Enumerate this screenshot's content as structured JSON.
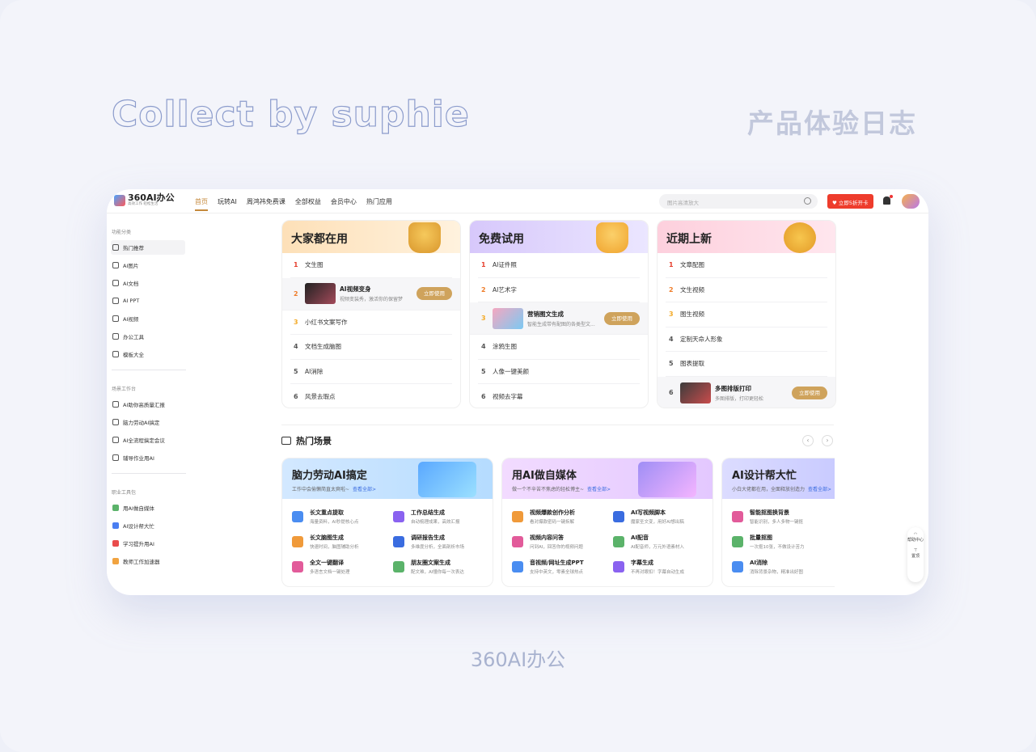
{
  "banner": {
    "left": "Collect by suphie",
    "right": "产品体验日志"
  },
  "caption": "360AI办公",
  "app": {
    "logo": {
      "name": "360AI办公",
      "slogan": "高效工作 轻松生活"
    },
    "nav": [
      "首页",
      "玩转AI",
      "周鸿祎免费课",
      "全部权益",
      "会员中心",
      "热门应用"
    ],
    "nav_active": "首页",
    "search_placeholder": "图片高清放大",
    "vip_button": "立即5折开卡",
    "colors": {
      "accent": "#c5893c",
      "vip": "#ee3c2c",
      "rank1": "#e6402f",
      "rank2": "#ef7d2a",
      "rank3": "#f3aa27"
    }
  },
  "sidebar": {
    "sections": [
      {
        "title": "功能分类",
        "items": [
          "热门推荐",
          "AI图片",
          "AI文档",
          "AI PPT",
          "AI视频",
          "办公工具",
          "模板大全"
        ],
        "icon_class": ""
      },
      {
        "title": "场景工作台",
        "items": [
          "AI助你高质量汇报",
          "脑力劳动AI搞定",
          "AI全流程搞定会议",
          "辅导作业用AI"
        ],
        "icon_class": ""
      },
      {
        "title": "职业工具包",
        "items": [
          "用AI做自媒体",
          "AI设计帮大忙",
          "学习提升用AI",
          "教师工作加速器"
        ],
        "icon_class": "colored"
      }
    ],
    "active": "热门推荐"
  },
  "rankings": [
    {
      "title": "大家都在用",
      "items": [
        {
          "n": "1",
          "label": "文生图"
        },
        {
          "n": "2",
          "label": "AI视频变身",
          "desc": "视频变装秀，激活你的保留梦",
          "button": "立即使用"
        },
        {
          "n": "3",
          "label": "小红书文案写作"
        },
        {
          "n": "4",
          "label": "文档生成脑图"
        },
        {
          "n": "5",
          "label": "AI消除"
        },
        {
          "n": "6",
          "label": "风景去瑕点"
        }
      ]
    },
    {
      "title": "免费试用",
      "items": [
        {
          "n": "1",
          "label": "AI证件照"
        },
        {
          "n": "2",
          "label": "AI艺术字"
        },
        {
          "n": "3",
          "label": "营销图文生成",
          "desc": "智能生成带有配图的各类型文...",
          "button": "立即使用"
        },
        {
          "n": "4",
          "label": "涂鸦生图"
        },
        {
          "n": "5",
          "label": "人像一键美颜"
        },
        {
          "n": "6",
          "label": "视频去字幕"
        }
      ]
    },
    {
      "title": "近期上新",
      "items": [
        {
          "n": "1",
          "label": "文章配图"
        },
        {
          "n": "2",
          "label": "文生视频"
        },
        {
          "n": "3",
          "label": "图生视频"
        },
        {
          "n": "4",
          "label": "定制天命人形象"
        },
        {
          "n": "5",
          "label": "图表提取"
        },
        {
          "n": "6",
          "label": "多图排版打印",
          "desc": "多图排版，打印更轻松",
          "button": "立即使用"
        }
      ]
    }
  ],
  "scenes": {
    "title": "热门场景",
    "prev": "‹",
    "next": "›",
    "cards": [
      {
        "title": "脑力劳动AI搞定",
        "sub": "工作中会偷懒简直太爽啦~",
        "more": "查看全部>",
        "tools": [
          {
            "t": "长文重点提取",
            "d": "海量资料，AI秒提核心点"
          },
          {
            "t": "工作总结生成",
            "d": "自动梳理成果，高效汇报"
          },
          {
            "t": "长文脑图生成",
            "d": "快速时间，脑图辅助分析"
          },
          {
            "t": "调研报告生成",
            "d": "多维度分析，全面剖析市场"
          },
          {
            "t": "全文一键翻译",
            "d": "多语言文档一键处理"
          },
          {
            "t": "朋友圈文案生成",
            "d": "配文难，AI懂你每一次表达"
          }
        ]
      },
      {
        "title": "用AI做自媒体",
        "sub": "做一个不辛苦不焦虑的轻松博主~",
        "more": "查看全部>",
        "tools": [
          {
            "t": "视频爆款创作分析",
            "d": "看对爆款密码一键拆解"
          },
          {
            "t": "AI写视频脚本",
            "d": "魔家圣文变，用好AI想出稿"
          },
          {
            "t": "视频内容问答",
            "d": "问到AI，回答你的视频问题"
          },
          {
            "t": "AI配音",
            "d": "AI配音师，万元外语素材入"
          },
          {
            "t": "音视频/网址生成PPT",
            "d": "支持中英文，零素全球热点"
          },
          {
            "t": "字幕生成",
            "d": "不再对眼扣！字幕自动生成"
          }
        ]
      },
      {
        "title": "AI设计帮大忙",
        "sub": "小白大佬都在用，全面释放创造力",
        "more": "查看全部>",
        "tools": [
          {
            "t": "智能抠图换背景",
            "d": "智能识别，多人多物一键抠"
          },
          {
            "t": "批量抠图",
            "d": "一次抠10张，不做设计苦力"
          },
          {
            "t": "AI消除",
            "d": "消除背景杂物，精准出好图"
          }
        ]
      }
    ]
  },
  "float_bar": {
    "help": "帮助中心",
    "top": "置顶"
  }
}
